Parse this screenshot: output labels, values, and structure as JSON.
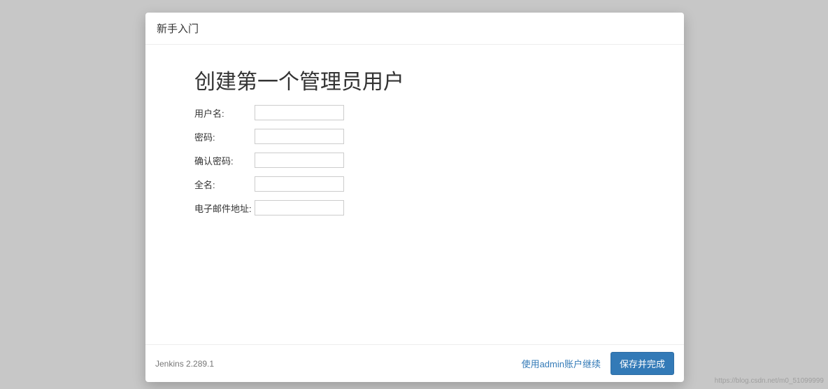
{
  "header": {
    "title": "新手入门"
  },
  "form": {
    "title": "创建第一个管理员用户",
    "fields": {
      "username": {
        "label": "用户名:",
        "value": ""
      },
      "password": {
        "label": "密码:",
        "value": ""
      },
      "confirm": {
        "label": "确认密码:",
        "value": ""
      },
      "fullname": {
        "label": "全名:",
        "value": ""
      },
      "email": {
        "label": "电子邮件地址:",
        "value": ""
      }
    }
  },
  "footer": {
    "version": "Jenkins 2.289.1",
    "skip_label": "使用admin账户继续",
    "save_label": "保存并完成"
  },
  "watermark": "https://blog.csdn.net/m0_51099999"
}
